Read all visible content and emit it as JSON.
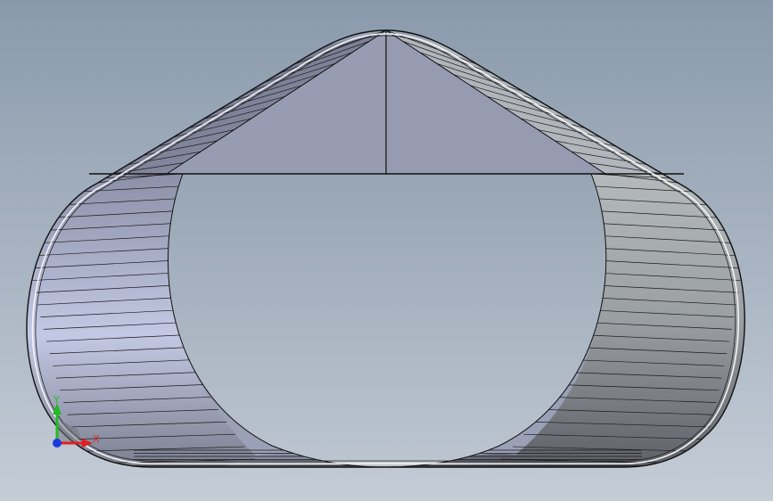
{
  "viewport": {
    "background_top": "#8a9aac",
    "background_bottom": "#c4ccd6"
  },
  "model": {
    "edge_color": "#111111",
    "cap_color": "#989cb2",
    "hole_color": "#a3b0bf"
  },
  "triad": {
    "x_label": "X",
    "y_label": "Y",
    "x_color": "#e02020",
    "y_color": "#22bb22",
    "z_color": "#1a3ae0"
  }
}
